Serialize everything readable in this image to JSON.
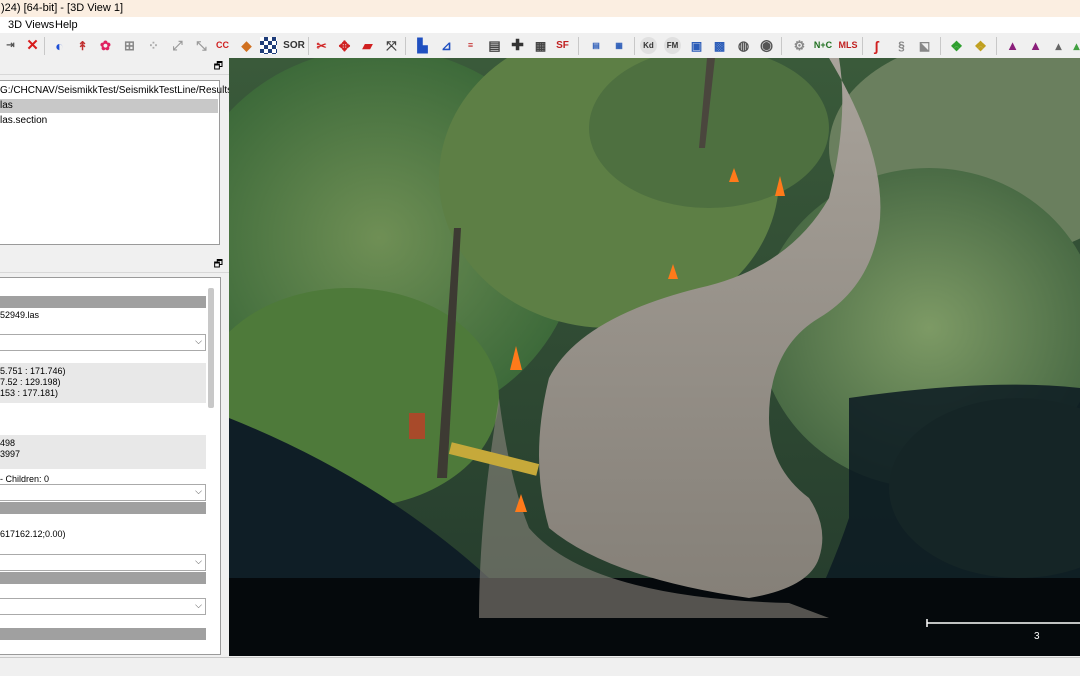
{
  "window": {
    "title": ")24) [64-bit] - [3D View 1]"
  },
  "menu": {
    "items": [
      "3D Views",
      "Help"
    ]
  },
  "toolbar": {
    "labels": {
      "cc": "CC",
      "sor": "SOR",
      "sf": "SF",
      "kd": "Kd",
      "fm": "FM",
      "nc": "N+C",
      "mls": "MLS"
    }
  },
  "db_tree": {
    "path": "G:/CHCNAV/SeismikkTest/SeismikkTestLine/Results/...",
    "items": [
      "las",
      "las.section"
    ]
  },
  "properties": {
    "filename": "52949.las",
    "box_line_1": "5.751 : 171.746)",
    "box_line_2": "7.52 : 129.198)",
    "box_line_3": "153 : 177.181)",
    "value_1": "498",
    "value_2": "3997",
    "children": "- Children: 0",
    "shift": "617162.12;0.00)"
  },
  "viewport": {
    "scale_label": "3"
  },
  "colors": {
    "titlebar": "#fbeee1",
    "selection": "#c8c8c8"
  }
}
